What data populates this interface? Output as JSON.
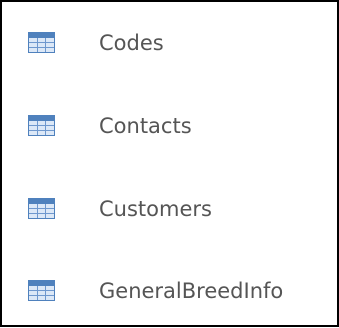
{
  "tables": [
    {
      "label": "Codes",
      "icon": "table-icon"
    },
    {
      "label": "Contacts",
      "icon": "table-icon"
    },
    {
      "label": "Customers",
      "icon": "table-icon"
    },
    {
      "label": "GeneralBreedInfo",
      "icon": "table-icon"
    }
  ],
  "colors": {
    "border": "#000000",
    "text": "#555555",
    "icon_header": "#4f81bd",
    "icon_grid": "#6f98ce",
    "icon_cell": "#dce8f7"
  }
}
